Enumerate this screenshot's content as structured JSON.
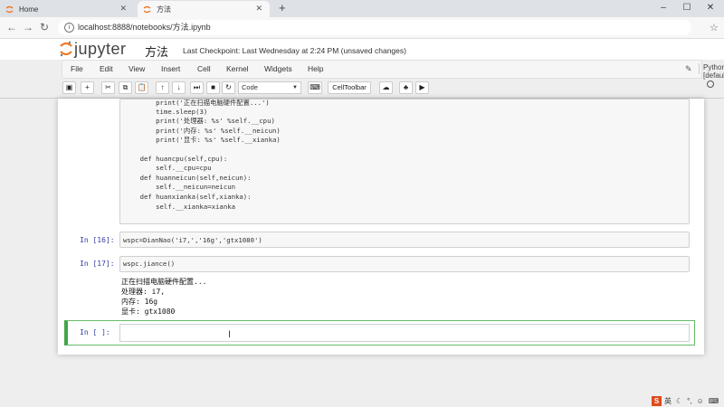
{
  "browser": {
    "tabs": [
      {
        "label": "Home"
      },
      {
        "label": "方法"
      }
    ],
    "url": "localhost:8888/notebooks/方法.ipynb"
  },
  "jupyter": {
    "logo_text": "jupyter",
    "notebook_name": "方法",
    "checkpoint": "Last Checkpoint: Last Wednesday at 2:24 PM (unsaved changes)",
    "menu": [
      "File",
      "Edit",
      "View",
      "Insert",
      "Cell",
      "Kernel",
      "Widgets",
      "Help"
    ],
    "kernel_name": "Python [default]",
    "toolbar": {
      "celltype_value": "Code",
      "celltoolbar_label": "CellToolbar"
    }
  },
  "cells": {
    "first_code": [
      "        print('正在扫描电脑硬件配置...')",
      "        time.sleep(3)",
      "        print('处理器: %s' %self.__cpu)",
      "        print('内存: %s' %self.__neicun)",
      "        print('显卡: %s' %self.__xianka)",
      "",
      "    def huancpu(self,cpu):",
      "        self.__cpu=cpu",
      "    def huanneicun(self,neicun):",
      "        self.__neicun=neicun",
      "    def huanxianka(self,xianka):",
      "        self.__xianka=xianka"
    ],
    "cell16": {
      "prompt": "In [16]:",
      "code": "wspc=DianNao('i7,','16g','gtx1080')"
    },
    "cell17": {
      "prompt": "In [17]:",
      "code": "wspc.jiance()",
      "output": [
        "正在扫描电脑硬件配置...",
        "处理器: i7,",
        "内存: 16g",
        "显卡: gtx1080"
      ]
    },
    "empty": {
      "prompt": "In [ ]:"
    }
  },
  "taskbar": {
    "ime": "英"
  }
}
